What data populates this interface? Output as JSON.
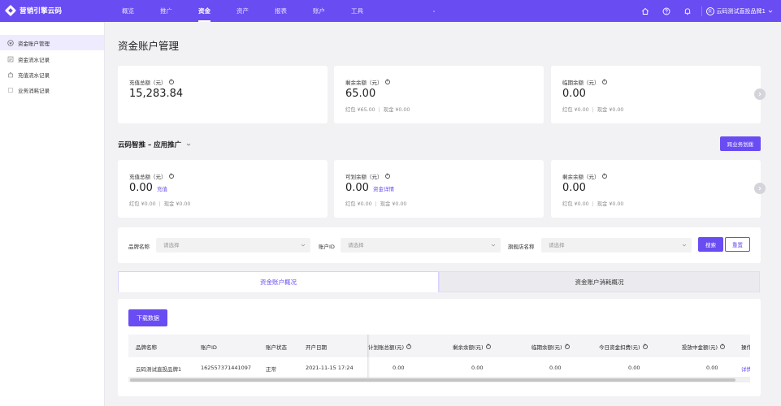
{
  "app": {
    "name": "营销引擎云码"
  },
  "nav": {
    "items": [
      "概览",
      "推广",
      "资金",
      "资产",
      "报表",
      "账户",
      "工具"
    ],
    "active_index": 2
  },
  "topbar": {
    "icons": [
      "home-icon",
      "help-icon",
      "bell-icon"
    ],
    "account_name": "云码测试直投品牌1",
    "account_badge": "云"
  },
  "sidebar": {
    "items": [
      {
        "label": "资金账户管理",
        "icon": "wallet-icon",
        "active": true
      },
      {
        "label": "资金流水记录",
        "icon": "ledger-icon",
        "active": false
      },
      {
        "label": "充值流水记录",
        "icon": "recharge-icon",
        "active": false
      },
      {
        "label": "业务消耗记录",
        "icon": "consumption-icon",
        "active": false
      }
    ]
  },
  "page": {
    "title": "资金账户管理"
  },
  "summary": {
    "cards": [
      {
        "label": "充值总额（元）",
        "value": "15,283.84",
        "sub": ""
      },
      {
        "label": "剩余余额（元）",
        "value": "65.00",
        "sub_red": "红包 ¥65.00",
        "sub_cash": "现金 ¥0.00"
      },
      {
        "label": "临期余额（元）",
        "value": "0.00",
        "sub_red": "红包 ¥0.00",
        "sub_cash": "现金 ¥0.00"
      }
    ]
  },
  "business": {
    "title": "云码智推 – 应用推广",
    "transfer_button": "跨业务划拨",
    "cards": [
      {
        "label": "充值总额（元）",
        "value": "0.00",
        "link": "充值",
        "sub_red": "红包 ¥0.00",
        "sub_cash": "现金 ¥0.00"
      },
      {
        "label": "可划余额（元）",
        "value": "0.00",
        "link": "资金详情",
        "sub_red": "红包 ¥0.00",
        "sub_cash": "现金 ¥0.00"
      },
      {
        "label": "剩余余额（元）",
        "value": "0.00",
        "link": "",
        "sub_red": "红包 ¥0.00",
        "sub_cash": "现金 ¥0.00"
      }
    ]
  },
  "filters": {
    "brand_label": "品牌名称",
    "brand_placeholder": "请选择",
    "account_label": "账户ID",
    "account_placeholder": "请选择",
    "store_label": "旗舰店名称",
    "store_placeholder": "请选择",
    "search_button": "搜索",
    "reset_button": "重置"
  },
  "tabs": [
    {
      "label": "资金账户概况",
      "active": true
    },
    {
      "label": "资金账户消耗概况",
      "active": false
    }
  ],
  "download_button": "下载数据",
  "table": {
    "columns": [
      "品牌名称",
      "账户ID",
      "账户状态",
      "开户日期",
      "计划账总额(元)",
      "剩余余额(元)",
      "临期余额(元)",
      "今日资金扣费(元)",
      "投放中金额(元)",
      "操作"
    ],
    "rows": [
      [
        "云码测试直投品牌1",
        "162557371441097",
        "正常",
        "2021-11-15 17:24",
        "0.00",
        "0.00",
        "0.00",
        "0.00",
        "0.00",
        "详情"
      ]
    ]
  }
}
